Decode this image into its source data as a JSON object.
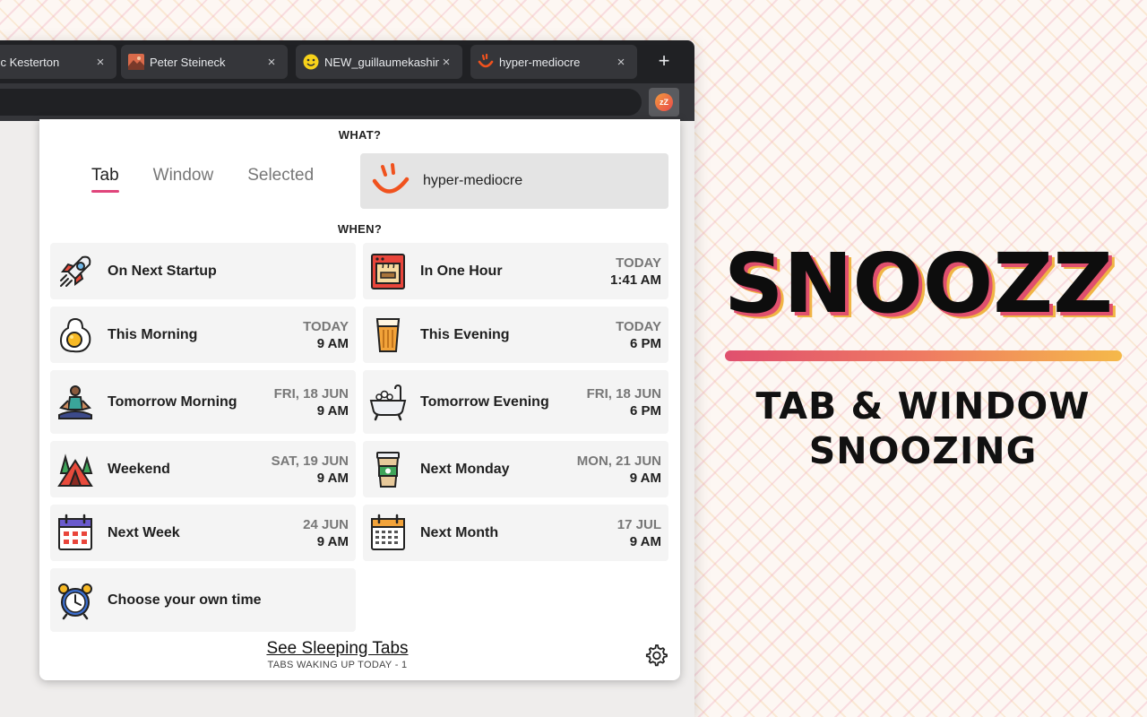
{
  "browser": {
    "tabs": [
      {
        "title": "Dominic Kesterton",
        "icon": "person-photo-icon"
      },
      {
        "title": "Peter Steineck",
        "icon": "landscape-photo-icon"
      },
      {
        "title": "NEW_guillaumekashima",
        "icon": "smiley-face-icon"
      },
      {
        "title": "hyper-mediocre",
        "icon": "hyper-mediocre-logo-icon"
      }
    ],
    "close_glyph": "×",
    "new_tab_glyph": "+",
    "extension_badge": "zZ"
  },
  "popup": {
    "what_label": "WHAT?",
    "when_label": "WHEN?",
    "modes": [
      "Tab",
      "Window",
      "Selected"
    ],
    "active_mode": "Tab",
    "preview_title": "hyper-mediocre",
    "options": [
      {
        "label": "On Next Startup",
        "day": "",
        "time": "",
        "icon": "rocket-icon"
      },
      {
        "label": "In One Hour",
        "day": "TODAY",
        "time": "1:41 AM",
        "icon": "oven-icon"
      },
      {
        "label": "This Morning",
        "day": "TODAY",
        "time": "9 AM",
        "icon": "fried-egg-icon"
      },
      {
        "label": "This Evening",
        "day": "TODAY",
        "time": "6 PM",
        "icon": "beer-glass-icon"
      },
      {
        "label": "Tomorrow Morning",
        "day": "FRI, 18 JUN",
        "time": "9 AM",
        "icon": "meditation-icon"
      },
      {
        "label": "Tomorrow Evening",
        "day": "FRI, 18 JUN",
        "time": "6 PM",
        "icon": "bathtub-icon"
      },
      {
        "label": "Weekend",
        "day": "SAT, 19 JUN",
        "time": "9 AM",
        "icon": "camping-tent-icon"
      },
      {
        "label": "Next Monday",
        "day": "MON, 21 JUN",
        "time": "9 AM",
        "icon": "coffee-cup-icon"
      },
      {
        "label": "Next Week",
        "day": "24 JUN",
        "time": "9 AM",
        "icon": "calendar-week-icon"
      },
      {
        "label": "Next Month",
        "day": "17 JUL",
        "time": "9 AM",
        "icon": "calendar-month-icon"
      },
      {
        "label": "Choose your own time",
        "day": "",
        "time": "",
        "icon": "alarm-clock-icon"
      }
    ],
    "see_sleeping_label": "See Sleeping Tabs",
    "waking_today": "TABS WAKING UP TODAY - 1"
  },
  "brand": {
    "logo_text": "SNOOZZ",
    "tagline_line1": "TAB & WINDOW",
    "tagline_line2": "SNOOZING"
  }
}
